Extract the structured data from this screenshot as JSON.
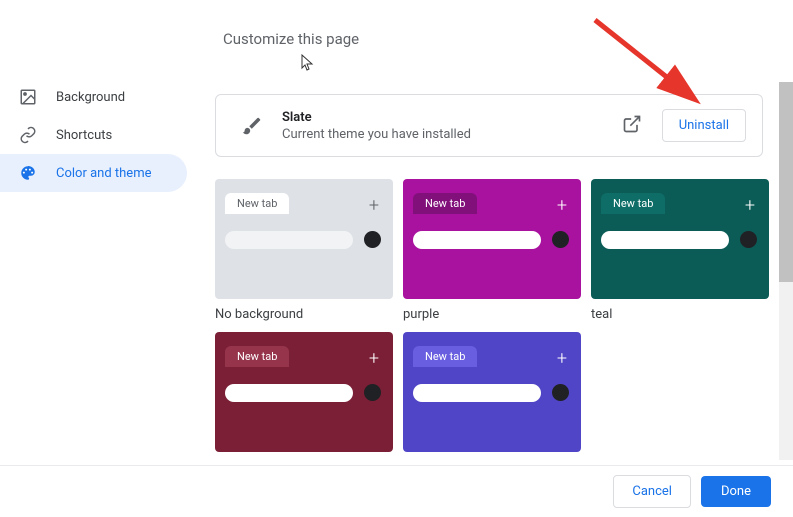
{
  "page_title": "Customize this page",
  "sidebar": {
    "items": [
      {
        "label": "Background"
      },
      {
        "label": "Shortcuts"
      },
      {
        "label": "Color and theme"
      }
    ]
  },
  "theme": {
    "name": "Slate",
    "desc": "Current theme you have installed",
    "uninstall_label": "Uninstall"
  },
  "tiles": [
    {
      "label": "No background",
      "bg": "#dee1e6",
      "tab_bg": "#ffffff",
      "tab_color": "#5f6368",
      "plus_color": "#5f6368",
      "search_bg": "#f1f3f4",
      "avatar_bg": "#202124",
      "new_tab": "New tab"
    },
    {
      "label": "purple",
      "bg": "#a8129e",
      "tab_bg": "#81107b",
      "tab_color": "#ffffff",
      "plus_color": "#ffffff",
      "search_bg": "#ffffff",
      "avatar_bg": "#202124",
      "new_tab": "New tab"
    },
    {
      "label": "teal",
      "bg": "#0b5c56",
      "tab_bg": "#0e6e67",
      "tab_color": "#ffffff",
      "plus_color": "#ffffff",
      "search_bg": "#ffffff",
      "avatar_bg": "#202124",
      "new_tab": "New tab"
    },
    {
      "label": "",
      "bg": "#7a1f35",
      "tab_bg": "#96344c",
      "tab_color": "#ffffff",
      "plus_color": "#ffffff",
      "search_bg": "#ffffff",
      "avatar_bg": "#202124",
      "new_tab": "New tab"
    },
    {
      "label": "",
      "bg": "#5045c7",
      "tab_bg": "#6a5ee0",
      "tab_color": "#ffffff",
      "plus_color": "#ffffff",
      "search_bg": "#ffffff",
      "avatar_bg": "#202124",
      "new_tab": "New tab"
    }
  ],
  "footer": {
    "cancel": "Cancel",
    "done": "Done"
  }
}
